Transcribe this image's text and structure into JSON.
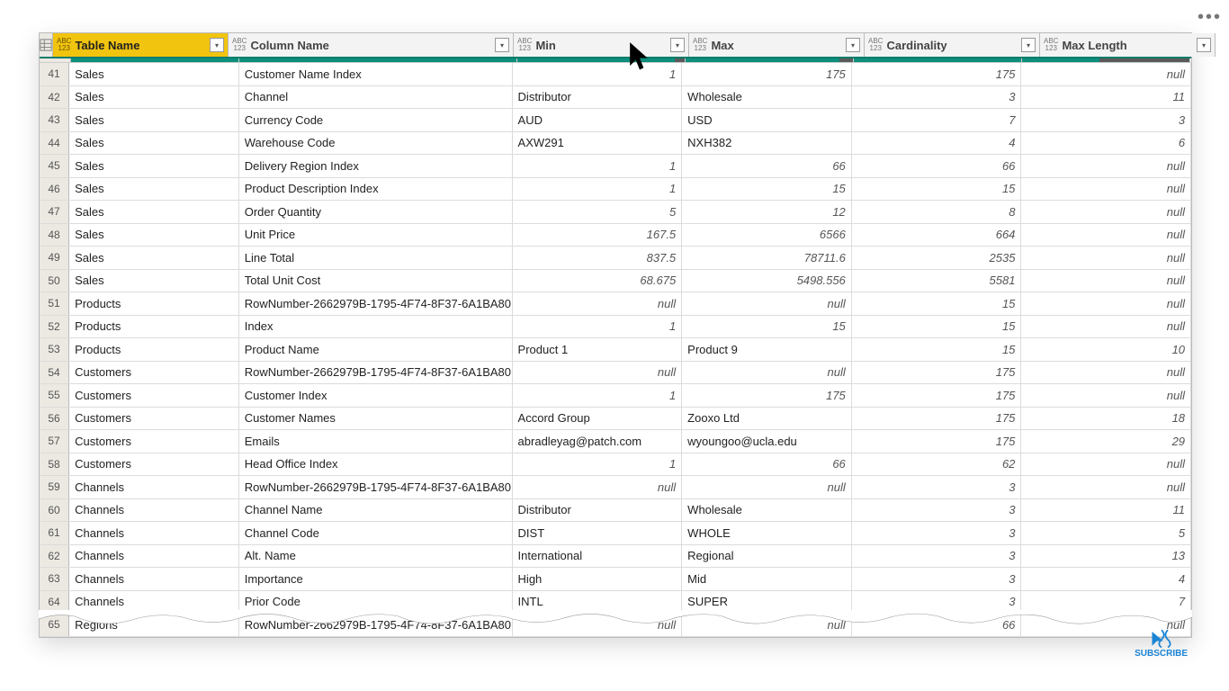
{
  "columns": [
    {
      "label": "Table Name",
      "type": "ABC123",
      "profilePct": 100,
      "selected": true
    },
    {
      "label": "Column Name",
      "type": "ABC123",
      "profilePct": 100,
      "selected": false
    },
    {
      "label": "Min",
      "type": "ABC123",
      "profilePct": 94,
      "selected": false
    },
    {
      "label": "Max",
      "type": "ABC123",
      "profilePct": 92,
      "selected": false
    },
    {
      "label": "Cardinality",
      "type": "ABC123",
      "profilePct": 100,
      "selected": false
    },
    {
      "label": "Max Length",
      "type": "ABC123",
      "profilePct": 46,
      "selected": false
    }
  ],
  "rows": [
    {
      "n": 41,
      "table": "Sales",
      "column": "Customer Name Index",
      "min": "1",
      "minNum": true,
      "max": "175",
      "maxNum": true,
      "card": "175",
      "mlen": "null"
    },
    {
      "n": 42,
      "table": "Sales",
      "column": "Channel",
      "min": "Distributor",
      "minNum": false,
      "max": "Wholesale",
      "maxNum": false,
      "card": "3",
      "mlen": "11"
    },
    {
      "n": 43,
      "table": "Sales",
      "column": "Currency Code",
      "min": "AUD",
      "minNum": false,
      "max": "USD",
      "maxNum": false,
      "card": "7",
      "mlen": "3"
    },
    {
      "n": 44,
      "table": "Sales",
      "column": "Warehouse Code",
      "min": "AXW291",
      "minNum": false,
      "max": "NXH382",
      "maxNum": false,
      "card": "4",
      "mlen": "6"
    },
    {
      "n": 45,
      "table": "Sales",
      "column": "Delivery Region Index",
      "min": "1",
      "minNum": true,
      "max": "66",
      "maxNum": true,
      "card": "66",
      "mlen": "null"
    },
    {
      "n": 46,
      "table": "Sales",
      "column": "Product Description Index",
      "min": "1",
      "minNum": true,
      "max": "15",
      "maxNum": true,
      "card": "15",
      "mlen": "null"
    },
    {
      "n": 47,
      "table": "Sales",
      "column": "Order Quantity",
      "min": "5",
      "minNum": true,
      "max": "12",
      "maxNum": true,
      "card": "8",
      "mlen": "null"
    },
    {
      "n": 48,
      "table": "Sales",
      "column": "Unit Price",
      "min": "167.5",
      "minNum": true,
      "max": "6566",
      "maxNum": true,
      "card": "664",
      "mlen": "null"
    },
    {
      "n": 49,
      "table": "Sales",
      "column": "Line Total",
      "min": "837.5",
      "minNum": true,
      "max": "78711.6",
      "maxNum": true,
      "card": "2535",
      "mlen": "null"
    },
    {
      "n": 50,
      "table": "Sales",
      "column": "Total Unit Cost",
      "min": "68.675",
      "minNum": true,
      "max": "5498.556",
      "maxNum": true,
      "card": "5581",
      "mlen": "null"
    },
    {
      "n": 51,
      "table": "Products",
      "column": "RowNumber-2662979B-1795-4F74-8F37-6A1BA80…",
      "min": "null",
      "minNum": true,
      "max": "null",
      "maxNum": true,
      "card": "15",
      "mlen": "null"
    },
    {
      "n": 52,
      "table": "Products",
      "column": "Index",
      "min": "1",
      "minNum": true,
      "max": "15",
      "maxNum": true,
      "card": "15",
      "mlen": "null"
    },
    {
      "n": 53,
      "table": "Products",
      "column": "Product Name",
      "min": "Product 1",
      "minNum": false,
      "max": "Product 9",
      "maxNum": false,
      "card": "15",
      "mlen": "10"
    },
    {
      "n": 54,
      "table": "Customers",
      "column": "RowNumber-2662979B-1795-4F74-8F37-6A1BA80…",
      "min": "null",
      "minNum": true,
      "max": "null",
      "maxNum": true,
      "card": "175",
      "mlen": "null"
    },
    {
      "n": 55,
      "table": "Customers",
      "column": "Customer Index",
      "min": "1",
      "minNum": true,
      "max": "175",
      "maxNum": true,
      "card": "175",
      "mlen": "null"
    },
    {
      "n": 56,
      "table": "Customers",
      "column": "Customer Names",
      "min": "Accord Group",
      "minNum": false,
      "max": "Zooxo Ltd",
      "maxNum": false,
      "card": "175",
      "mlen": "18"
    },
    {
      "n": 57,
      "table": "Customers",
      "column": "Emails",
      "min": "abradleyag@patch.com",
      "minNum": false,
      "max": "wyoungoo@ucla.edu",
      "maxNum": false,
      "card": "175",
      "mlen": "29"
    },
    {
      "n": 58,
      "table": "Customers",
      "column": "Head Office Index",
      "min": "1",
      "minNum": true,
      "max": "66",
      "maxNum": true,
      "card": "62",
      "mlen": "null"
    },
    {
      "n": 59,
      "table": "Channels",
      "column": "RowNumber-2662979B-1795-4F74-8F37-6A1BA80…",
      "min": "null",
      "minNum": true,
      "max": "null",
      "maxNum": true,
      "card": "3",
      "mlen": "null"
    },
    {
      "n": 60,
      "table": "Channels",
      "column": "Channel Name",
      "min": "Distributor",
      "minNum": false,
      "max": "Wholesale",
      "maxNum": false,
      "card": "3",
      "mlen": "11"
    },
    {
      "n": 61,
      "table": "Channels",
      "column": "Channel Code",
      "min": "DIST",
      "minNum": false,
      "max": "WHOLE",
      "maxNum": false,
      "card": "3",
      "mlen": "5"
    },
    {
      "n": 62,
      "table": "Channels",
      "column": "Alt. Name",
      "min": "International",
      "minNum": false,
      "max": "Regional",
      "maxNum": false,
      "card": "3",
      "mlen": "13"
    },
    {
      "n": 63,
      "table": "Channels",
      "column": "Importance",
      "min": "High",
      "minNum": false,
      "max": "Mid",
      "maxNum": false,
      "card": "3",
      "mlen": "4"
    },
    {
      "n": 64,
      "table": "Channels",
      "column": "Prior Code",
      "min": "INTL",
      "minNum": false,
      "max": "SUPER",
      "maxNum": false,
      "card": "3",
      "mlen": "7"
    },
    {
      "n": 65,
      "table": "Regions",
      "column": "RowNumber-2662979B-1795-4F74-8F37-6A1BA80…",
      "min": "null",
      "minNum": true,
      "max": "null",
      "maxNum": true,
      "card": "66",
      "mlen": "null"
    }
  ],
  "subscribe_label": "SUBSCRIBE"
}
